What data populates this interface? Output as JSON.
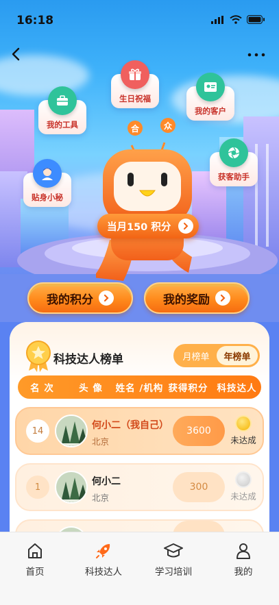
{
  "status_bar": {
    "time": "16:18"
  },
  "feature_bubbles": [
    {
      "label": "生日祝福",
      "icon": "gift-icon",
      "color": "#f0605e"
    },
    {
      "label": "我的工具",
      "icon": "toolbox-icon",
      "color": "#2fc39a"
    },
    {
      "label": "我的客户",
      "icon": "id-card-icon",
      "color": "#2fc39a"
    },
    {
      "label": "获客助手",
      "icon": "camera-aperture-icon",
      "color": "#2fc39a"
    },
    {
      "label": "贴身小秘",
      "icon": "secretary-avatar-icon",
      "color": "#3d8cff"
    }
  ],
  "mascot": {
    "antenna_left": "合",
    "antenna_right": "众",
    "points_label": "当月150 积分"
  },
  "actions": {
    "my_points": "我的积分",
    "my_rewards": "我的奖励"
  },
  "leaderboard": {
    "title": "科技达人榜单",
    "segments": [
      "月榜单",
      "年榜单"
    ],
    "active_segment": "年榜单",
    "columns": [
      "名 次",
      "头 像",
      "姓名 /机构",
      "获得积分",
      "科技达人"
    ],
    "rows": [
      {
        "rank": "14",
        "name": "何小二（我自己）",
        "org": "北京",
        "points": "3600",
        "status": "未达成",
        "is_me": true
      },
      {
        "rank": "1",
        "name": "何小二",
        "org": "北京",
        "points": "300",
        "status": "未达成",
        "is_me": false
      }
    ]
  },
  "tabbar": [
    {
      "label": "首页",
      "icon": "home-icon"
    },
    {
      "label": "科技达人",
      "icon": "rocket-icon",
      "active": true,
      "color": "#ff6a1a"
    },
    {
      "label": "学习培训",
      "icon": "graduation-cap-icon"
    },
    {
      "label": "我的",
      "icon": "user-icon"
    }
  ]
}
